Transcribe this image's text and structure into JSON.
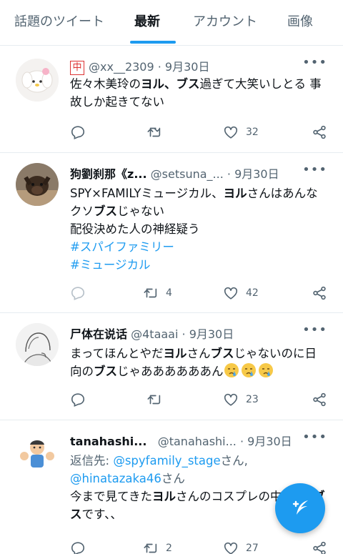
{
  "tabs": [
    {
      "label": "話題のツイート"
    },
    {
      "label": "最新"
    },
    {
      "label": "アカウント"
    },
    {
      "label": "画像"
    }
  ],
  "tweets": [
    {
      "badge": "中",
      "name": "",
      "handle": "@xx__2309",
      "date": "· 9月30日",
      "text_parts": [
        "佐々木美玲の",
        "ヨル",
        "、",
        "ブス",
        "過ぎて大笑いしとる 事故しか起きてない"
      ],
      "replies": "",
      "retweets": "",
      "likes": "32"
    },
    {
      "name": "狗劉刹那《z...",
      "handle": "@setsuna_...",
      "date": "· 9月30日",
      "text_parts": [
        "SPY×FAMILYミュージカル、",
        "ヨル",
        "さんはあんなクソ",
        "ブス",
        "じゃない",
        "配役決めた人の神経疑う"
      ],
      "hashtags": [
        "#スパイファミリー",
        "#ミュージカル"
      ],
      "retweets": "4",
      "likes": "42"
    },
    {
      "name": "尸体在说话",
      "handle": "@4taaai",
      "date": "· 9月30日",
      "text_parts": [
        "まってほんとやだ",
        "ヨル",
        "さん",
        "ブス",
        "じゃないのに日向の",
        "ブス",
        "じゃああああああん"
      ],
      "retweets": "",
      "likes": "23"
    },
    {
      "name": "tanahashi...",
      "handle": "@tanahashi...",
      "date": "· 9月30日",
      "reply_prefix": "返信先:",
      "reply_to_1": "@spyfamily_stage",
      "reply_mid": "さん,",
      "reply_to_2": "@hinatazaka46",
      "reply_end": "さん",
      "text_parts": [
        "今まで見てきた",
        "ヨル",
        "さんのコスプレの中で1番",
        "ブス",
        "です、、"
      ],
      "retweets": "2",
      "likes": "27"
    }
  ],
  "colors": {
    "accent": "#1d9bf0",
    "text": "#0f1419",
    "muted": "#536471"
  },
  "icons": [
    "reply-icon",
    "retweet-icon",
    "like-icon",
    "share-icon",
    "more-icon",
    "compose-icon"
  ]
}
